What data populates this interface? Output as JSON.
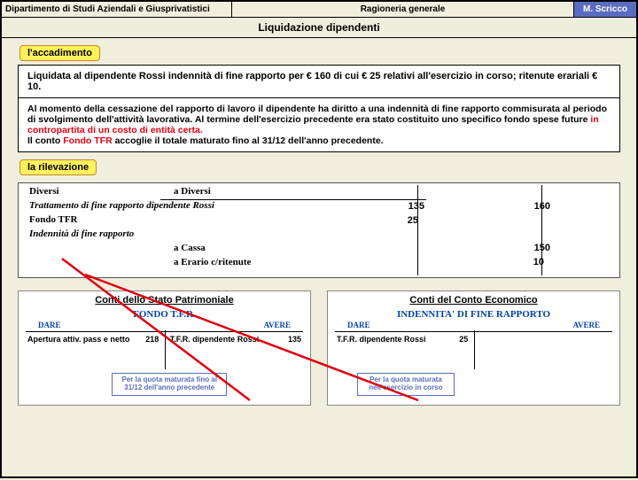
{
  "header": {
    "dept": "Dipartimento di Studi Aziendali e Giusprivatistici",
    "course": "Ragioneria generale",
    "author": "M. Scricco"
  },
  "title": "Liquidazione dipendenti",
  "chip1": "l'accadimento",
  "panel": {
    "p1": "Liquidata al dipendente Rossi indennità di fine rapporto per € 160 di cui € 25 relativi all'esercizio in corso; ritenute erariali € 10.",
    "p2": "Al momento della cessazione del rapporto di lavoro il dipendente ha diritto a una indennità di fine rapporto commisurata al periodo di svolgimento dell'attività lavorativa. Al termine dell'esercizio precedente era stato costituito uno specifico fondo spese future ",
    "p2_red": "in contropartita di un costo di entità certa.",
    "p2b": "Il conto ",
    "p2b_red": "Fondo TFR",
    "p2c": " accoglie il totale maturato fino al 31/12 dell'anno precedente."
  },
  "chip2": "la rilevazione",
  "journal": {
    "diversiA": "Diversi",
    "aDiversi": "a   Diversi",
    "line1": "Trattamento di fine rapporto dipendente Rossi",
    "line2": "Fondo TFR",
    "line3": "Indennità di fine rapporto",
    "line4": "a   Cassa",
    "line5": "a   Erario c/ritenute",
    "v135": "135",
    "v25": "25",
    "v160": "160",
    "v150": "150",
    "v10": "10"
  },
  "accounts": {
    "title_sp": "Conti dello Stato Patrimoniale",
    "title_ce": "Conti del Conto Economico",
    "ledger1": {
      "name": "FONDO T.F.R.",
      "dare": "DARE",
      "avere": "AVERE",
      "left_label": "Apertura attiv. pass e netto",
      "left_amt": "218",
      "right_label": "T.F.R. dipendente Rossi",
      "right_amt": "135",
      "note": "Per la quota maturata fino al 31/12 dell'anno precedente"
    },
    "ledger2": {
      "name": "INDENNITA' DI FINE RAPPORTO",
      "dare": "DARE",
      "avere": "AVERE",
      "left_label": "T.F.R. dipendente Rossi",
      "left_amt": "25",
      "note": "Per la quota maturata nell'esercizio in corso"
    }
  }
}
